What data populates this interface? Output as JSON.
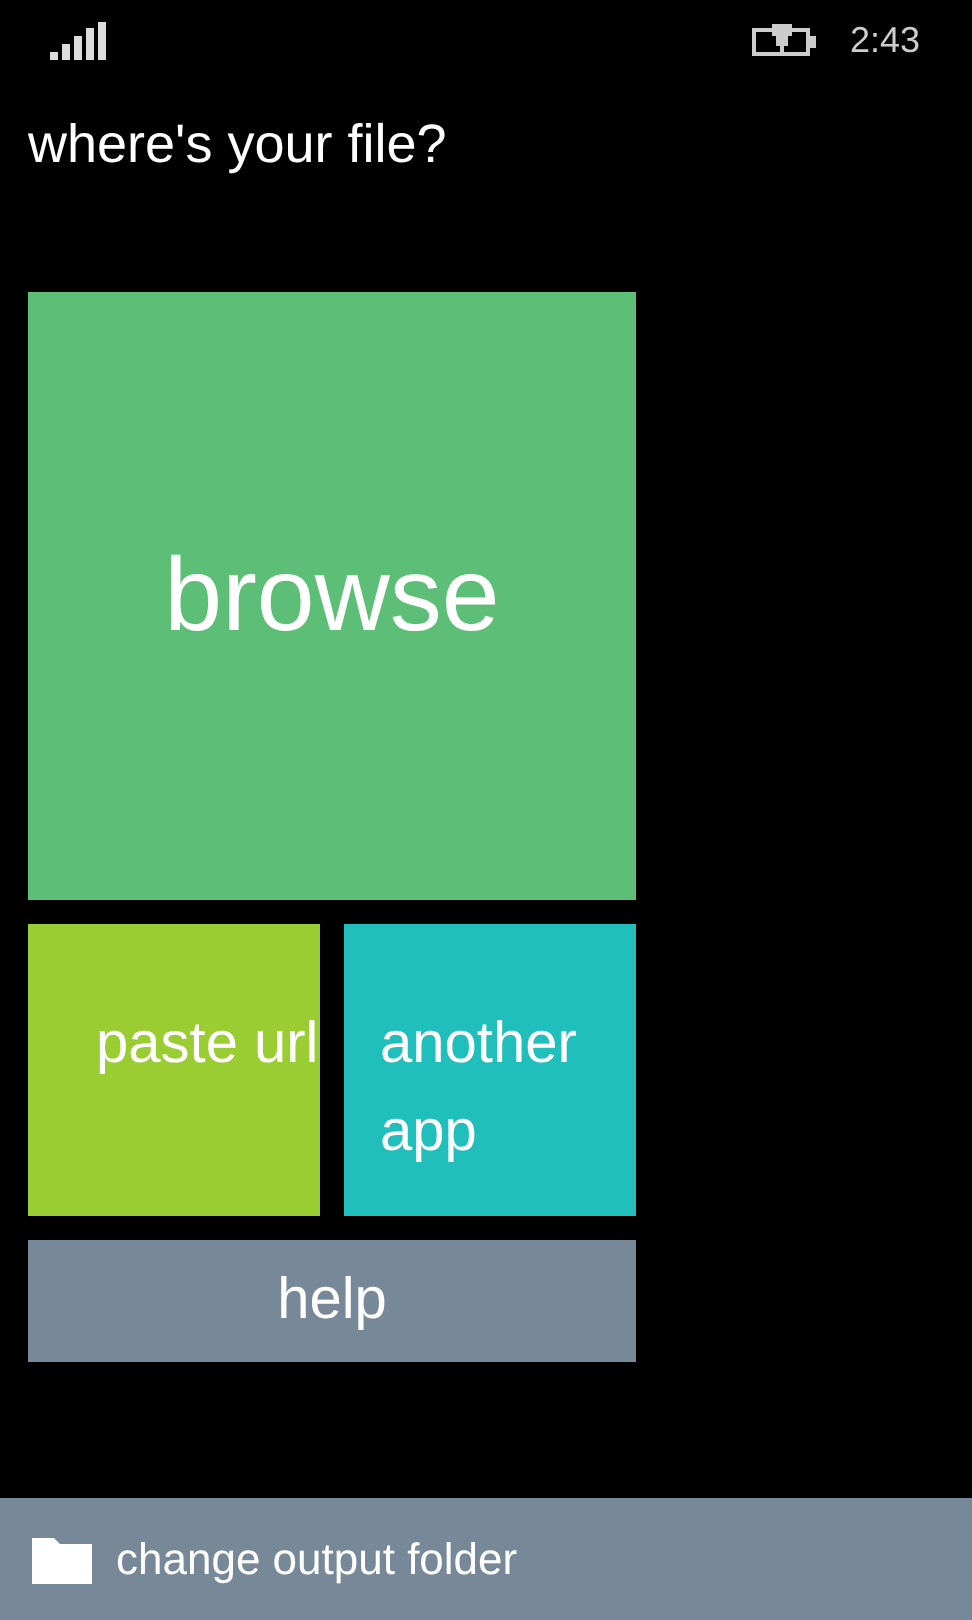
{
  "status_bar": {
    "time": "2:43"
  },
  "title": "where's your file?",
  "tiles": [
    {
      "label": "browse",
      "kind": "large",
      "color": "#5dbf77"
    },
    {
      "label": "paste url",
      "kind": "small",
      "color": "#9acd32"
    },
    {
      "label": "another app",
      "kind": "small",
      "color": "#20bfbb"
    },
    {
      "label": "help",
      "kind": "wide",
      "color": "#778899"
    }
  ],
  "app_bar": {
    "label": "change output folder"
  }
}
